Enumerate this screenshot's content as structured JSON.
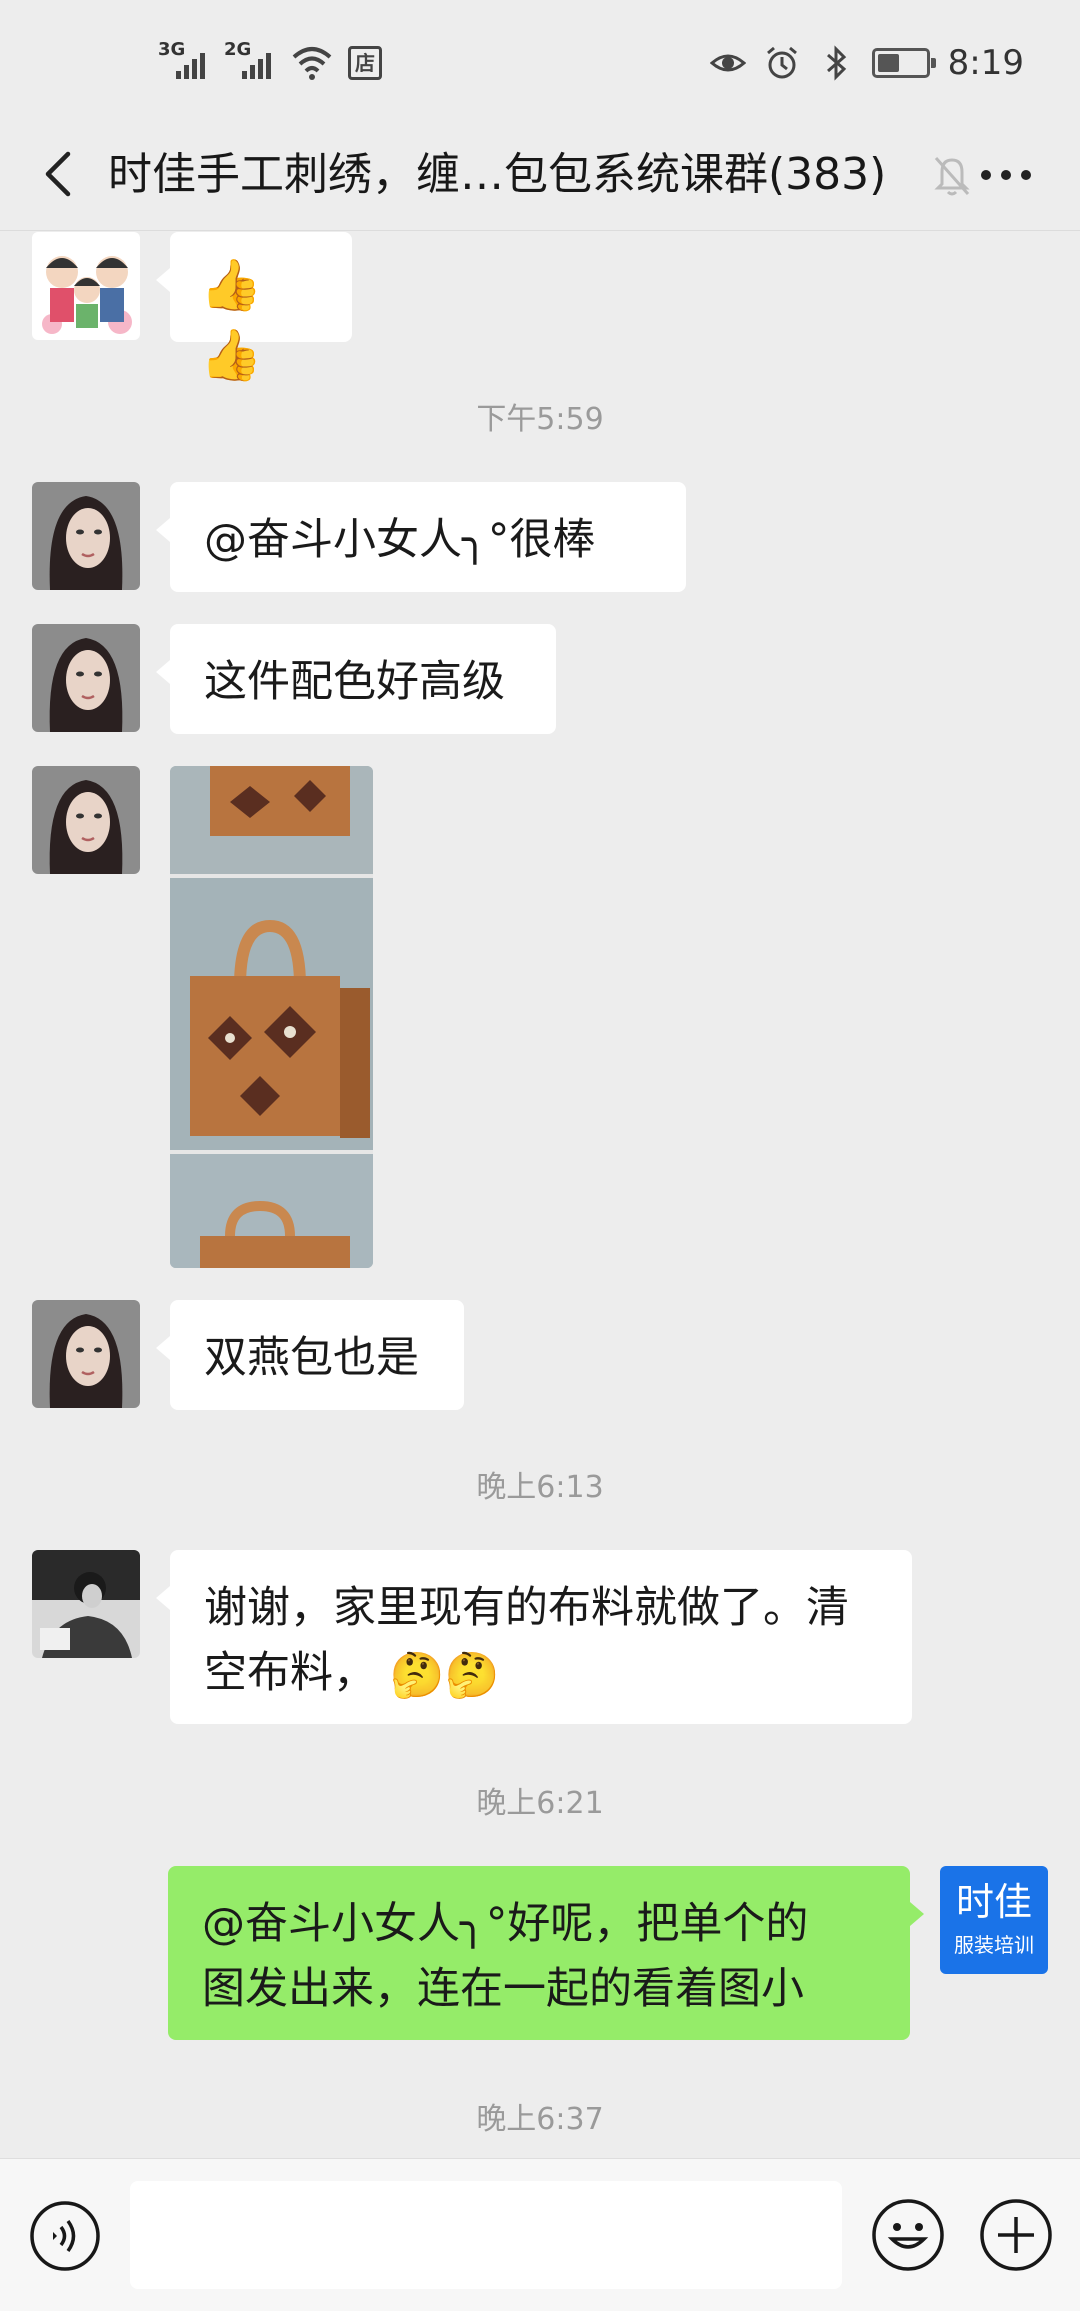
{
  "status_bar": {
    "signal1": "3G",
    "signal2": "2G",
    "store_label": "店",
    "time": "8:19",
    "icons": [
      "eye-icon",
      "alarm-icon",
      "bluetooth-icon",
      "battery-icon"
    ],
    "battery_level": 0.45
  },
  "header": {
    "title": "时佳手工刺绣，缠…包包系统课群(383)",
    "icons": [
      "back-icon",
      "mute-bell-icon",
      "more-icon"
    ]
  },
  "messages": [
    {
      "type": "emoji",
      "content": "👍👍",
      "avatar": "cartoon-family-avatar"
    },
    {
      "type": "timestamp",
      "text": "下午5:59"
    },
    {
      "type": "text",
      "text": "@奋斗小女人╮°很棒",
      "avatar": "woman-avatar"
    },
    {
      "type": "text",
      "text": "这件配色好高级",
      "avatar": "woman-avatar"
    },
    {
      "type": "image",
      "description": "orange bag photos",
      "avatar": "woman-avatar"
    },
    {
      "type": "text",
      "text": "双燕包也是",
      "avatar": "woman-avatar"
    },
    {
      "type": "timestamp",
      "text": "晚上6:13"
    },
    {
      "type": "text",
      "text_line1": "谢谢，家里现有的布料就做了。清",
      "text_line2": "空布料，",
      "emoji": "🤔🤔",
      "avatar": "bw-photo-avatar"
    },
    {
      "type": "timestamp",
      "text": "晚上6:21"
    },
    {
      "type": "text",
      "self": true,
      "text_line1": "@奋斗小女人╮°好呢，把单个的",
      "text_line2": "图发出来，连在一起的看着图小",
      "avatar": "shijia-logo-avatar"
    },
    {
      "type": "timestamp",
      "text": "晚上6:37"
    }
  ],
  "self_avatar": {
    "line1": "时佳",
    "line2": "服装培训",
    "bg": "#1a73e8"
  },
  "input_bar": {
    "text_value": "",
    "icons": [
      "voice-icon",
      "emoji-icon",
      "plus-icon"
    ]
  },
  "colors": {
    "self_bubble": "#95ec69",
    "background": "#ededed",
    "bubble": "#ffffff"
  }
}
